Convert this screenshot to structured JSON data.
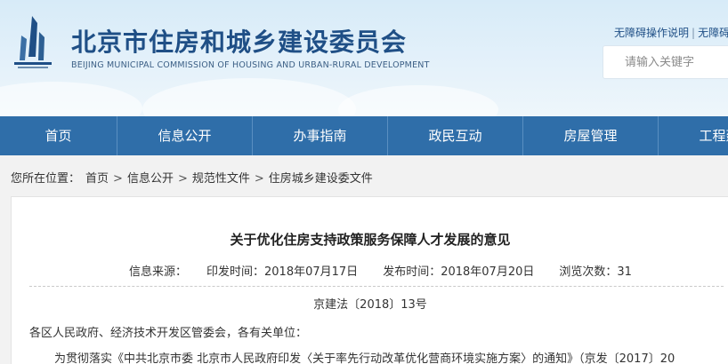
{
  "header": {
    "title": "北京市住房和城乡建设委员会",
    "subtitle": "BEIJING MUNICIPAL COMMISSION OF HOUSING AND URBAN-RURAL DEVELOPMENT",
    "accessibility_links": [
      "无障碍操作说明",
      "无障碍"
    ],
    "search_placeholder": "请输入关键字",
    "colors": {
      "title": "#1f4f86",
      "nav": "#2f6ea9"
    }
  },
  "nav": {
    "items": [
      "首页",
      "信息公开",
      "办事指南",
      "政民互动",
      "房屋管理",
      "工程建设"
    ]
  },
  "breadcrumb": {
    "label": "您所在位置：",
    "items": [
      "首页",
      "信息公开",
      "规范性文件",
      "住房城乡建设委文件"
    ],
    "separator": ">"
  },
  "article": {
    "title": "关于优化住房支持政策服务保障人才发展的意见",
    "meta": {
      "source": "信息来源：",
      "issue_date": "印发时间：2018年07月17日",
      "publish_date": "发布时间：2018年07月20日",
      "views": "浏览次数：31"
    },
    "doc_number": "京建法〔2018〕13号",
    "paragraphs": [
      "各区人民政府、经济技术开发区管委会，各有关单位：",
      "为贯彻落实《中共北京市委 北京市人民政府印发〈关于率先行动改革优化营商环境实施方案〉的通知》（京发〔2017〕20"
    ]
  }
}
